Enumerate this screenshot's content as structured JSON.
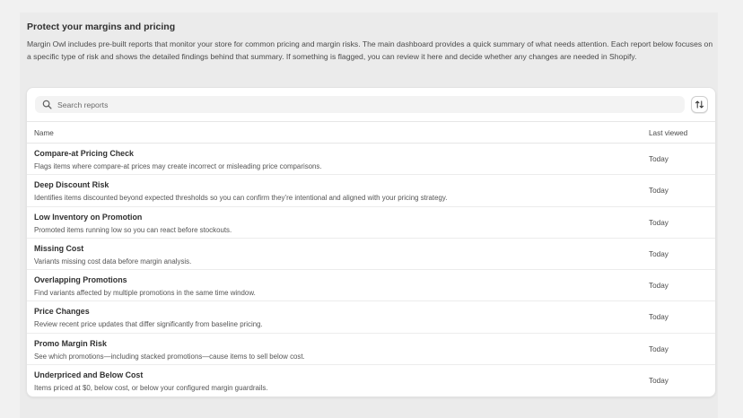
{
  "section": {
    "title": "Protect your margins and pricing",
    "description": "Margin Owl includes pre-built reports that monitor your store for common pricing and margin risks. The main dashboard provides a quick summary of what needs attention. Each report below focuses on a specific type of risk and shows the detailed findings behind that summary. If something is flagged, you can review it here and decide whether any changes are needed in Shopify."
  },
  "search": {
    "placeholder": "Search reports",
    "value": "",
    "icon": "search-icon"
  },
  "sort": {
    "icon": "sort-arrows-icon"
  },
  "table": {
    "columns": [
      "Name",
      "Last viewed"
    ],
    "rows": [
      {
        "title": "Compare-at Pricing Check",
        "description": "Flags items where compare-at prices may create incorrect or misleading price comparisons.",
        "last_viewed": "Today"
      },
      {
        "title": "Deep Discount Risk",
        "description": "Identifies items discounted beyond expected thresholds so you can confirm they’re intentional and aligned with your pricing strategy.",
        "last_viewed": "Today"
      },
      {
        "title": "Low Inventory on Promotion",
        "description": "Promoted items running low so you can react before stockouts.",
        "last_viewed": "Today"
      },
      {
        "title": "Missing Cost",
        "description": "Variants missing cost data before margin analysis.",
        "last_viewed": "Today"
      },
      {
        "title": "Overlapping Promotions",
        "description": "Find variants affected by multiple promotions in the same time window.",
        "last_viewed": "Today"
      },
      {
        "title": "Price Changes",
        "description": "Review recent price updates that differ significantly from baseline pricing.",
        "last_viewed": "Today"
      },
      {
        "title": "Promo Margin Risk",
        "description": "See which promotions—including stacked promotions—cause items to sell below cost.",
        "last_viewed": "Today"
      },
      {
        "title": "Underpriced and Below Cost",
        "description": "Items priced at $0, below cost, or below your configured margin guardrails.",
        "last_viewed": "Today"
      }
    ]
  }
}
